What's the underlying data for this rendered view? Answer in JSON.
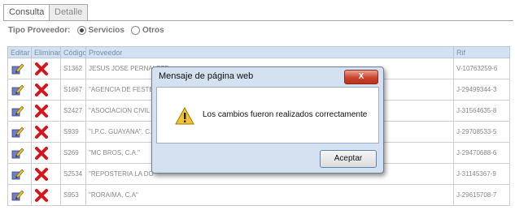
{
  "tabs": [
    {
      "label": "Consulta",
      "active": true
    },
    {
      "label": "Detalle",
      "active": false
    }
  ],
  "filter": {
    "label": "Tipo Proveedor:",
    "options": [
      {
        "label": "Servicios",
        "selected": true
      },
      {
        "label": "Otros",
        "selected": false
      }
    ]
  },
  "table": {
    "columns": [
      "Editar",
      "Eliminar",
      "Código",
      "Proveedor",
      "Rif"
    ],
    "rows": [
      {
        "code": "S1362",
        "provider": "JESUS JOSE PERNALETE",
        "rif": "V-10763259-6"
      },
      {
        "code": "S1667",
        "provider": "\"AGENCIA DE FESTEJ",
        "rif": "J-29499344-3"
      },
      {
        "code": "S2427",
        "provider": "\"ASOCIACION CIVIL TI",
        "rif": "J-31564635-8"
      },
      {
        "code": "S939",
        "provider": "\"I.P.C. GUAYANA\", C.",
        "rif": "J-29708533-5"
      },
      {
        "code": "S269",
        "provider": "\"MC BROS, C.A.\"",
        "rif": "J-29470688-6"
      },
      {
        "code": "S2534",
        "provider": "\"REPOSTERIA LA DO",
        "rif": "J-31145367-9"
      },
      {
        "code": "S953",
        "provider": "\"RORAIMA, C.A\"",
        "rif": "J-29615708-7"
      }
    ]
  },
  "dialog": {
    "title": "Mensaje de página web",
    "close": "X",
    "message": "Los cambios fueron realizados correctamente",
    "button": "Aceptar"
  },
  "colors": {
    "header_bg": "#d3e2f3",
    "dialog_bg": "#d3e1f0",
    "close_red": "#c9442c",
    "delete_red": "#d2161b"
  }
}
